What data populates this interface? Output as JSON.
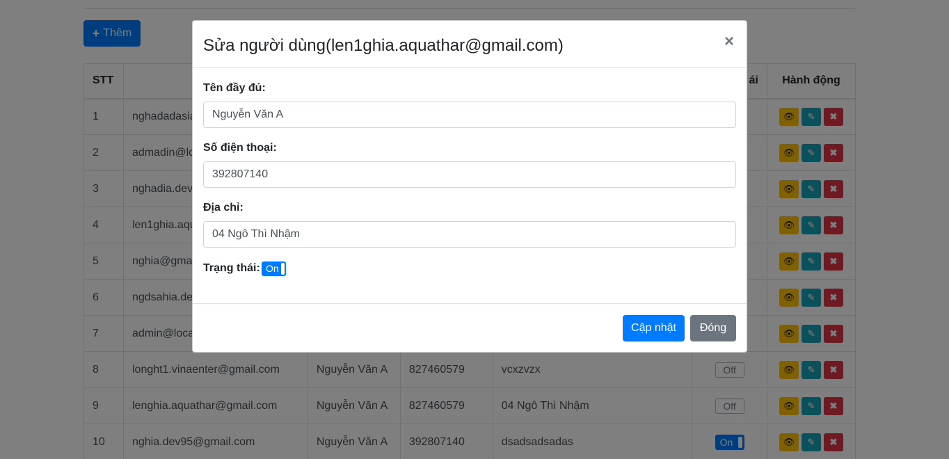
{
  "toolbar": {
    "add_label": "Thêm"
  },
  "table": {
    "headers": {
      "stt": "STT",
      "status": "ái",
      "actions": "Hành động"
    },
    "rows": [
      {
        "stt": "1",
        "email": "nghadadasia",
        "name": "",
        "phone": "",
        "address": "",
        "status": ""
      },
      {
        "stt": "2",
        "email": "admadin@lo",
        "name": "",
        "phone": "",
        "address": "",
        "status": ""
      },
      {
        "stt": "3",
        "email": "nghadia.dev",
        "name": "",
        "phone": "",
        "address": "",
        "status": ""
      },
      {
        "stt": "4",
        "email": "len1ghia.aqu",
        "name": "",
        "phone": "",
        "address": "",
        "status": ""
      },
      {
        "stt": "5",
        "email": "nghia@gma",
        "name": "",
        "phone": "",
        "address": "",
        "status": ""
      },
      {
        "stt": "6",
        "email": "ngdsahia.de",
        "name": "",
        "phone": "",
        "address": "",
        "status": ""
      },
      {
        "stt": "7",
        "email": "admin@loca",
        "name": "",
        "phone": "",
        "address": "",
        "status": ""
      },
      {
        "stt": "8",
        "email": "longht1.vinaenter@gmail.com",
        "name": "Nguyễn Văn A",
        "phone": "827460579",
        "address": "vcxzvzx",
        "status": "Off"
      },
      {
        "stt": "9",
        "email": "lenghia.aquathar@gmail.com",
        "name": "Nguyễn Văn A",
        "phone": "827460579",
        "address": "04 Ngô Thì Nhậm",
        "status": "Off"
      },
      {
        "stt": "10",
        "email": "nghia.dev95@gmail.com",
        "name": "Nguyễn Văn A",
        "phone": "392807140",
        "address": "dsadsadsadas",
        "status": "On"
      }
    ]
  },
  "modal": {
    "title": "Sửa người dùng(len1ghia.aquathar@gmail.com)",
    "close": "×",
    "fullname_label": "Tên đầy đủ:",
    "fullname_value": "Nguyễn Văn A",
    "phone_label": "Số điện thoại:",
    "phone_value": "392807140",
    "address_label": "Địa chỉ:",
    "address_value": "04 Ngô Thì Nhậm",
    "status_label": "Trạng thái:",
    "status_value": "On",
    "update_label": "Cập nhật",
    "close_label": "Đóng"
  },
  "icons": {
    "add": "plus-icon",
    "view": "eye-icon",
    "edit": "edit-icon",
    "delete": "x-icon"
  },
  "colors": {
    "primary": "#007bff",
    "warning": "#ffc107",
    "info": "#17a2b8",
    "danger": "#dc3545",
    "secondary": "#6c757d"
  }
}
